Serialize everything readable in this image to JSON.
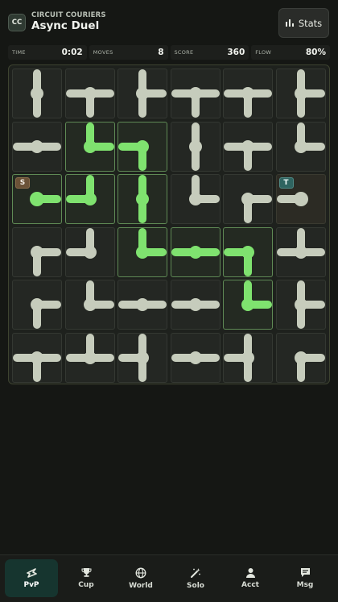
{
  "header": {
    "logo_text": "CC",
    "brand": "CIRCUIT COURIERS",
    "mode": "Async Duel",
    "stats_label": "Stats",
    "stats_icon": "bar-chart-icon"
  },
  "status": [
    {
      "label": "TIME",
      "value": "0:02"
    },
    {
      "label": "MOVES",
      "value": "8"
    },
    {
      "label": "SCORE",
      "value": "360"
    },
    {
      "label": "FLOW",
      "value": "80%"
    }
  ],
  "colors": {
    "pipe_idle": "#c6ccbc",
    "pipe_lit": "#7fe26f",
    "lit_border": "#5f8a55",
    "source_badge": "#6b5238",
    "target_badge": "#2f6460",
    "nav_active": "#16352f"
  },
  "board": {
    "rows": 6,
    "cols": 6,
    "source": {
      "row": 2,
      "col": 0,
      "label": "S"
    },
    "target": {
      "row": 2,
      "col": 5,
      "label": "T"
    },
    "tiles": [
      [
        {
          "c": "NS",
          "lit": false
        },
        {
          "c": "EWS",
          "lit": false
        },
        {
          "c": "NES",
          "lit": false
        },
        {
          "c": "EWS",
          "lit": false
        },
        {
          "c": "EWS",
          "lit": false
        },
        {
          "c": "NES",
          "lit": false
        }
      ],
      [
        {
          "c": "EW",
          "lit": false
        },
        {
          "c": "NE",
          "lit": true
        },
        {
          "c": "SW",
          "lit": true
        },
        {
          "c": "NS",
          "lit": false
        },
        {
          "c": "EWS",
          "lit": false
        },
        {
          "c": "NE",
          "lit": false
        }
      ],
      [
        {
          "c": "E",
          "lit": true
        },
        {
          "c": "NW",
          "lit": true
        },
        {
          "c": "NS",
          "lit": true
        },
        {
          "c": "NE",
          "lit": false
        },
        {
          "c": "SE",
          "lit": false
        },
        {
          "c": "W",
          "lit": false
        }
      ],
      [
        {
          "c": "SE",
          "lit": false
        },
        {
          "c": "NW",
          "lit": false
        },
        {
          "c": "NE",
          "lit": true
        },
        {
          "c": "EW",
          "lit": true
        },
        {
          "c": "SW",
          "lit": true
        },
        {
          "c": "NEW",
          "lit": false
        }
      ],
      [
        {
          "c": "SE",
          "lit": false
        },
        {
          "c": "NE",
          "lit": false
        },
        {
          "c": "EW",
          "lit": false
        },
        {
          "c": "EW",
          "lit": false
        },
        {
          "c": "NE",
          "lit": true
        },
        {
          "c": "NES",
          "lit": false
        }
      ],
      [
        {
          "c": "EWS",
          "lit": false
        },
        {
          "c": "NEW",
          "lit": false
        },
        {
          "c": "NSW",
          "lit": false
        },
        {
          "c": "EW",
          "lit": false
        },
        {
          "c": "NSW",
          "lit": false
        },
        {
          "c": "SE",
          "lit": false
        }
      ]
    ]
  },
  "nav": [
    {
      "label": "PvP",
      "icon": "pvp-icon",
      "active": true
    },
    {
      "label": "Cup",
      "icon": "trophy-icon",
      "active": false
    },
    {
      "label": "World",
      "icon": "globe-icon",
      "active": false
    },
    {
      "label": "Solo",
      "icon": "magic-wand-icon",
      "active": false
    },
    {
      "label": "Acct",
      "icon": "user-icon",
      "active": false
    },
    {
      "label": "Msg",
      "icon": "message-icon",
      "active": false
    }
  ]
}
